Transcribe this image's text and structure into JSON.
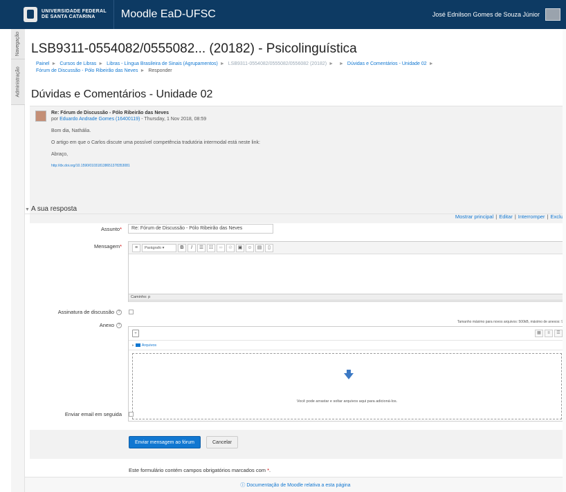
{
  "header": {
    "university_line1": "UNIVERSIDADE FEDERAL",
    "university_line2": "DE SANTA CATARINA",
    "site_name": "Moodle EaD-UFSC",
    "user_name": "José Ednilson Gomes de Souza Júnior"
  },
  "side_tabs": [
    "Navegação",
    "Administração"
  ],
  "page": {
    "course_title": "LSB9311-0554082/0555082... (20182) - Psicolinguística",
    "forum_heading": "Dúvidas e Comentários - Unidade 02"
  },
  "breadcrumb": {
    "items": [
      "Painel",
      "Cursos de Libras",
      "Libras - Língua Brasileira de Sinais (Agrupamentos)",
      "LSB9311-0554082/0555082/0556082 (20182)",
      "",
      "Dúvidas e Comentários - Unidade 02",
      "Fórum de Discussão - Pólo Ribeirão das Neves"
    ],
    "current": "Responder"
  },
  "post": {
    "subject": "Re: Fórum de Discussão - Pólo Ribeirão das Neves",
    "by_prefix": "por",
    "author": "Eduardo Andrade Gomes (16400119)",
    "date": "- Thursday, 1 Nov 2018, 08:59",
    "greeting": "Bom dia, Nathália.",
    "body": "O artigo em que o Carlos discute uma possível competência tradutória intermodal está neste link:",
    "signoff": "Abraço,",
    "link": "http://dx.doi.org/10.1590/010318138651378353081",
    "commands": [
      "Mostrar principal",
      "Editar",
      "Interromper",
      "Excluir"
    ]
  },
  "form": {
    "legend": "A sua resposta",
    "subject_label": "Assunto",
    "subject_value": "Re: Fórum de Discussão - Pólo Ribeirão das Neves",
    "message_label": "Mensagem",
    "editor_format": "Parágrafo",
    "editor_path": "Caminho: p",
    "signature_label": "Assinatura de discussão",
    "attachment_label": "Anexo",
    "attachment_max": "Tamanho máximo para novos arquivos: 500kB, máximo de anexos: 9",
    "files_folder": "Arquivos",
    "drop_text": "Você pode arrastar e soltar arquivos aqui para adicioná-los.",
    "email_label": "Enviar email em seguida",
    "submit_label": "Enviar mensagem ao fórum",
    "cancel_label": "Cancelar",
    "required_note": "Este formulário contém campos obrigatórios marcados com",
    "required_star": "*",
    "required_period": "."
  },
  "footer": {
    "doc_link": "Documentação de Moodle relativa a esta página"
  },
  "colors": {
    "header_bg": "#0d3a63",
    "link": "#1177d1",
    "required": "#cc0000"
  }
}
